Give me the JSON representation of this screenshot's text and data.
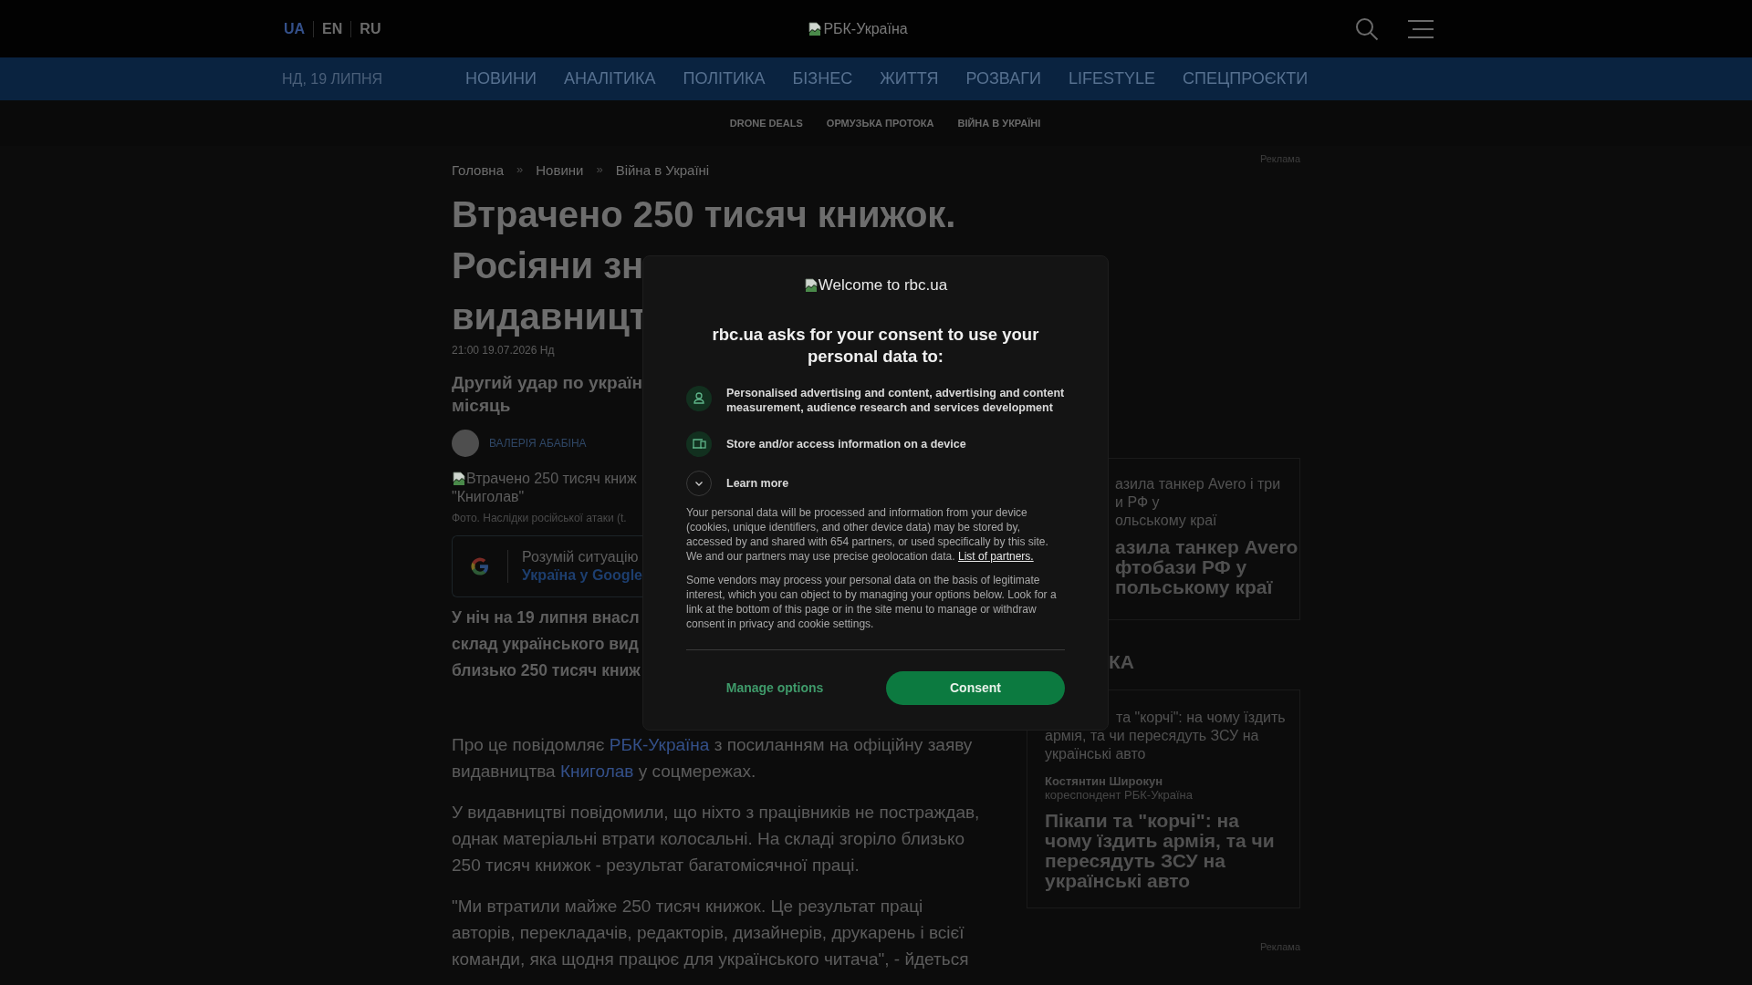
{
  "header": {
    "languages": [
      {
        "label": "UA",
        "selected": true
      },
      {
        "label": "EN",
        "selected": false
      },
      {
        "label": "RU",
        "selected": false
      }
    ],
    "logo_alt": "РБК-Україна"
  },
  "nav": {
    "date": "НД, 19 ЛИПНЯ",
    "items": [
      "НОВИНИ",
      "АНАЛІТИКА",
      "ПОЛІТИКА",
      "БІЗНЕС",
      "ЖИТТЯ",
      "РОЗВАГИ",
      "LIFESTYLE",
      "СПЕЦПРОЄКТИ"
    ]
  },
  "subnav": [
    "DRONE DEALS",
    "ОРМУЗЬКА ПРОТОКА",
    "ВІЙНА В УКРАЇНІ"
  ],
  "article": {
    "breadcrumbs": [
      {
        "kind": "link",
        "text": "Головна"
      },
      {
        "kind": "separator",
        "text": "»"
      },
      {
        "kind": "link",
        "text": "Новини"
      },
      {
        "kind": "separator",
        "text": "»"
      },
      {
        "kind": "link",
        "text": "Війна в Україні"
      }
    ],
    "title_lines": [
      "Втрачено 250 тисяч книжок.",
      "Росіяни зн",
      "видавницт"
    ],
    "date": "21:00 19.07.2026 Нд",
    "lead_lines": [
      "Другий удар по україн",
      "місяць"
    ],
    "author": "ВАЛЕРІЯ АБАБІНА",
    "image_alt_lines": [
      "Втрачено 250 тисяч книж",
      "\"Книголав\""
    ],
    "caption": "Фото. Наслідки російської атаки (t.",
    "google_promo": {
      "text": "Розумій ситуацію",
      "link": "Україна у Google"
    },
    "paragraphs": [
      {
        "kind": "lead",
        "lines": [
          "У ніч на 19 липня внасл",
          "склад українського вид",
          "близько 250 тисяч книж"
        ]
      },
      {
        "kind": "body",
        "runs": [
          {
            "text": "Про це повідомляє ",
            "link": false
          },
          {
            "text": "РБК-Україна",
            "link": true
          },
          {
            "text": " з посиланням на офіційну заяву видавництва ",
            "link": false
          },
          {
            "text": "Книголав",
            "link": true
          },
          {
            "text": " у соцмережах.",
            "link": false
          }
        ]
      },
      {
        "kind": "body",
        "runs": [
          {
            "text": "У видавництві повідомили, що ніхто з працівників не постраждав, однак матеріальні втрати колосальні. На складі згоріло близько 250 тисяч книжок - результат багатомісячної праці.",
            "link": false
          }
        ]
      },
      {
        "kind": "body",
        "runs": [
          {
            "text": "\"Ми втратили майже 250 тисяч книжок. Це результат праці авторів, перекладачів, редакторів, дизайнерів, друкарень і всієї команди, яка щодня працює для українського читача\", - йдеться",
            "link": false
          }
        ]
      }
    ]
  },
  "sidebar": {
    "ad_label_top": "Реклама",
    "news_card": {
      "lines": [
        "азила танкер Avero і три",
        "и РФ у",
        "ольському краї"
      ],
      "title_lines": [
        "азила танкер Avero",
        "фтобази РФ у",
        "польському краї"
      ]
    },
    "section_heading": "КА",
    "analytics_card": {
      "lines": [
        "та \"корчі\": на чому їздить",
        "армія, та чи пересядуть ЗСУ на",
        "українські авто"
      ],
      "author": "Костянтин Широкун",
      "author_role": "кореспондент РБК-Україна",
      "title": "Пікапи та \"корчі\": на чому їздить армія, та чи пересядуть ЗСУ на українські авто"
    },
    "ad_label_bottom": "Реклама"
  },
  "consent": {
    "logo_alt": "Welcome to rbc.ua",
    "heading": "rbc.ua asks for your consent to use your personal data to:",
    "purposes": [
      {
        "kind": "person",
        "text": "Personalised advertising and content, advertising and content measurement, audience research and services development"
      },
      {
        "kind": "device",
        "text": "Store and/or access information on a device"
      }
    ],
    "learn_more": {
      "label": "Learn more",
      "expanded": false
    },
    "paragraphs": [
      [
        {
          "text": "Your personal data will be processed and information from your device (cookies, unique identifiers, and other device data) may be stored by, accessed by and shared with 654 partners, or used specifically by this site. We and our partners may use precise geolocation data. ",
          "link": false
        },
        {
          "text": "List of partners.",
          "link": true
        }
      ],
      [
        {
          "text": "Some vendors may process your personal data on the basis of legitimate interest, which you can object to by managing your options below. Look for a link at the bottom of this page or in the site menu to manage or withdraw consent in privacy and cookie settings.",
          "link": false
        }
      ]
    ],
    "buttons": [
      {
        "kind": "secondary",
        "label": "Manage options"
      },
      {
        "kind": "primary",
        "label": "Consent"
      }
    ]
  }
}
